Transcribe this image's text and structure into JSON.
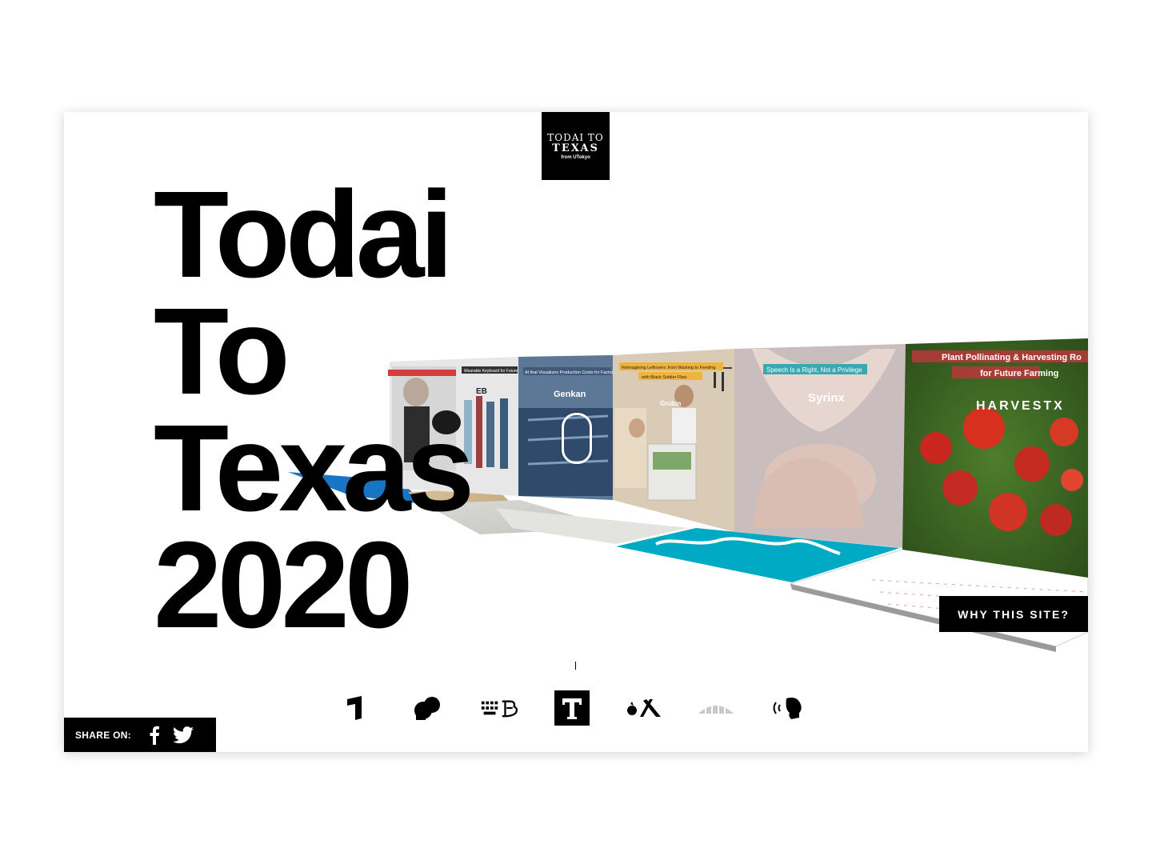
{
  "logo": {
    "line1": "TODAI TO",
    "line2": "TEXAS",
    "line3": "from UTokyo"
  },
  "hero": {
    "line1": "Todai",
    "line2": "To",
    "line3": "Texas",
    "line4": "2020"
  },
  "panels": [
    {
      "caption1": "",
      "caption2": "Wearable Keyboard for Future Devices",
      "brand": ""
    },
    {
      "caption1": "AI that Visualizes Production Costs for Factories",
      "brand": "Genkan"
    },
    {
      "caption1": "Reimagining Leftovers: from Wasting to Feeding",
      "caption2": "with Black Soldier Flies",
      "brand": "Grubin"
    },
    {
      "caption1": "Speech Is a Right, Not a Privilege",
      "brand": "Syrinx"
    },
    {
      "caption1": "Plant Pollinating & Harvesting Ro",
      "caption2": "for Future Farming",
      "brand": "HARVESTX"
    }
  ],
  "why_button": "WHY THIS SITE?",
  "share": {
    "label": "SHARE ON:",
    "facebook": "facebook-icon",
    "twitter": "twitter-icon"
  },
  "startup_icons": [
    "genkan-logo-icon",
    "boxing-glove-icon",
    "keyboard-logo-icon",
    "t-logo-icon",
    "harvestx-logo-icon",
    "grubin-logo-icon",
    "syrinx-voice-icon"
  ],
  "colors": {
    "accent_cyan": "#00aac4",
    "black": "#000000",
    "floor_blue": "#1874c4"
  }
}
